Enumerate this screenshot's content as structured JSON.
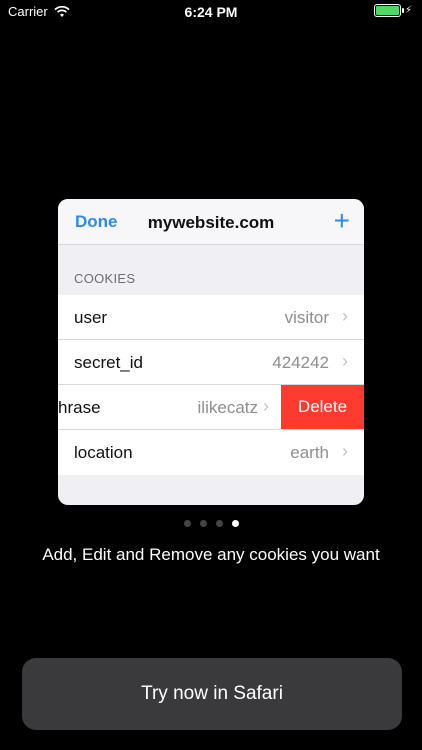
{
  "status_bar": {
    "carrier": "Carrier",
    "time": "6:24 PM"
  },
  "card": {
    "nav": {
      "done_label": "Done",
      "title": "mywebsite.com",
      "add_label": "+"
    },
    "section_header": "COOKIES",
    "rows": [
      {
        "key": "user",
        "value": "visitor"
      },
      {
        "key": "secret_id",
        "value": "424242"
      },
      {
        "key": "hrase",
        "value": "ilikecatz",
        "delete_label": "Delete"
      },
      {
        "key": "location",
        "value": "earth"
      }
    ]
  },
  "page_indicator": {
    "count": 4,
    "active_index": 3
  },
  "caption": "Add, Edit and Remove any cookies you want",
  "cta_label": "Try now in Safari",
  "colors": {
    "accent": "#2e8aea",
    "delete": "#ff3b30",
    "battery": "#4cd964"
  }
}
